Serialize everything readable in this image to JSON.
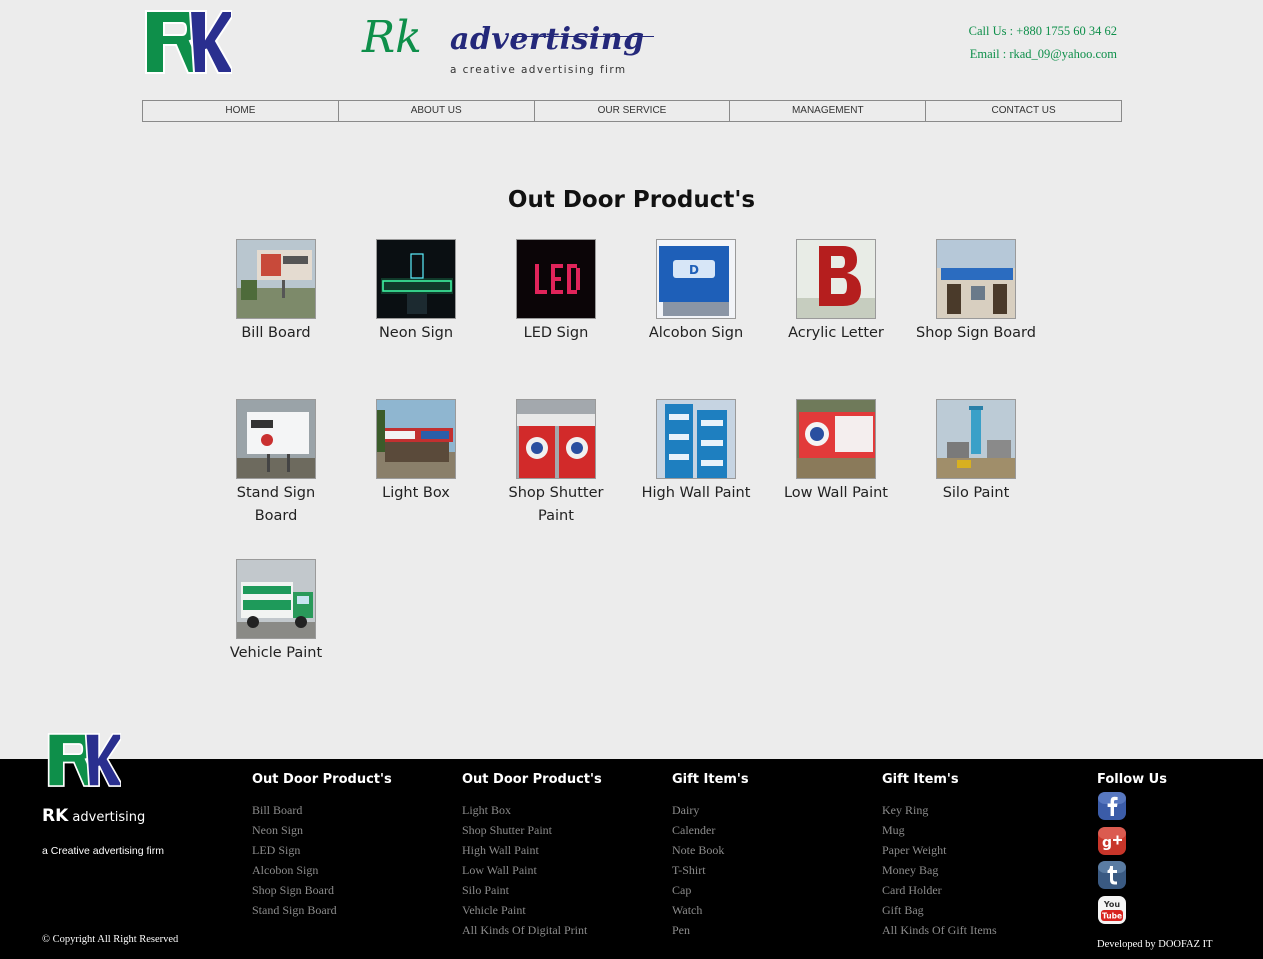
{
  "header": {
    "logo_text": "RK",
    "brand_rk": "Rk",
    "brand_name": "advertising",
    "tagline": "a creative advertising firm",
    "phone": "Call Us : +880 1755 60 34 62",
    "email": "Email : rkad_09@yahoo.com"
  },
  "nav": {
    "items": [
      "HOME",
      "ABOUT US",
      "OUR SERVICE",
      "MANAGEMENT",
      "CONTACT US"
    ]
  },
  "main": {
    "title": "Out Door Product's",
    "products": [
      {
        "label": "Bill Board"
      },
      {
        "label": "Neon Sign"
      },
      {
        "label": "LED Sign"
      },
      {
        "label": "Alcobon Sign"
      },
      {
        "label": "Acrylic Letter"
      },
      {
        "label": "Shop Sign Board"
      },
      {
        "label": "Stand Sign Board"
      },
      {
        "label": "Light Box"
      },
      {
        "label": "Shop Shutter Paint"
      },
      {
        "label": "High Wall Paint"
      },
      {
        "label": "Low Wall Paint"
      },
      {
        "label": "Silo Paint"
      },
      {
        "label": "Vehicle Paint"
      }
    ]
  },
  "footer": {
    "brand_bold": "RK",
    "brand_rest": "advertising",
    "tagline": "a Creative advertising firm",
    "copyright": "© Copyright All Right Reserved",
    "developed": "Developed by DOOFAZ IT",
    "columns": [
      {
        "title": "Out Door Product's",
        "links": [
          "Bill Board",
          "Neon Sign",
          "LED Sign",
          "Alcobon Sign",
          "Shop Sign Board",
          "Stand Sign Board"
        ]
      },
      {
        "title": "Out Door Product's",
        "links": [
          "Light Box",
          "Shop Shutter Paint",
          "High Wall Paint",
          "Low Wall Paint",
          "Silo Paint",
          "Vehicle Paint",
          "All Kinds Of Digital Print"
        ]
      },
      {
        "title": "Gift Item's",
        "links": [
          "Dairy",
          "Calender",
          "Note Book",
          "T-Shirt",
          "Cap",
          "Watch",
          "Pen"
        ]
      },
      {
        "title": "Gift Item's",
        "links": [
          "Key Ring",
          "Mug",
          "Paper Weight",
          "Money Bag",
          "Card Holder",
          "Gift Bag",
          "All Kinds Of Gift Items"
        ]
      }
    ],
    "follow_title": "Follow Us",
    "social": [
      "facebook-icon",
      "google-plus-icon",
      "tumblr-icon",
      "youtube-icon"
    ]
  },
  "colors": {
    "brand_green": "#0e8f4a",
    "brand_navy": "#24287a",
    "page_bg": "#ececec",
    "footer_bg": "#000000",
    "footer_link": "#8c8c8c"
  }
}
